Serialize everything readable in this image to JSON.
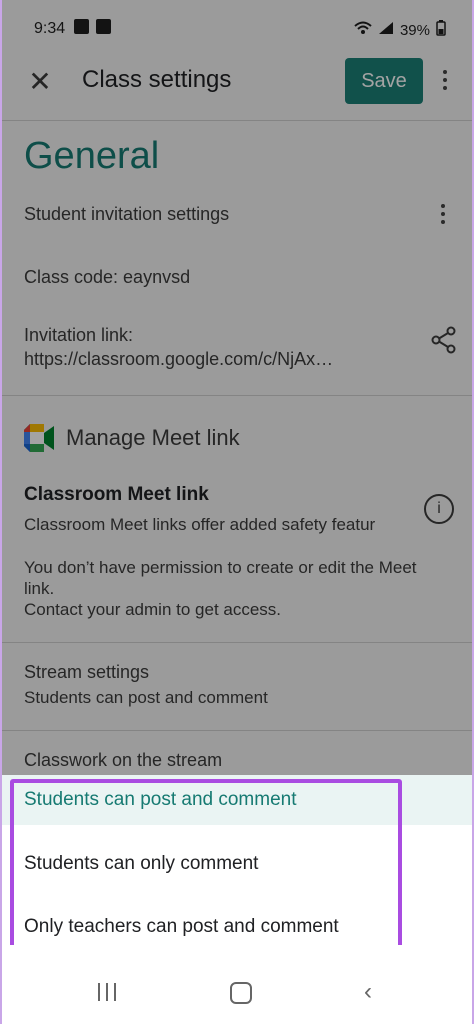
{
  "status_bar": {
    "time": "9:34",
    "battery": "39%"
  },
  "app_bar": {
    "title": "Class settings",
    "save_label": "Save"
  },
  "general": {
    "heading": "General",
    "student_invitation": "Student invitation settings",
    "class_code": "Class code: eaynvsd",
    "invitation_link_label": "Invitation link:",
    "invitation_link_value": "https://classroom.google.com/c/NjAx…"
  },
  "meet": {
    "heading": "Manage Meet link",
    "classroom_meet_title": "Classroom Meet link",
    "classroom_meet_desc": "Classroom Meet links offer added safety featur",
    "permission_line1": "You don’t have permission to create or edit the Meet",
    "permission_line2": "link.",
    "permission_line3": "Contact your admin to get access."
  },
  "stream": {
    "title": "Stream settings",
    "value": "Students can post and comment",
    "classwork": "Classwork on the stream"
  },
  "sheet_options": [
    {
      "label": "Students can post and comment",
      "selected": true
    },
    {
      "label": "Students can only comment",
      "selected": false
    },
    {
      "label": "Only teachers can post and comment",
      "selected": false
    }
  ],
  "colors": {
    "accent": "#167a72",
    "save_bg": "#1b7f76",
    "highlight_border": "#a94ce1"
  },
  "icons": [
    "close-icon",
    "more-vert-icon",
    "share-icon",
    "google-meet-icon",
    "info-icon",
    "recents-icon",
    "home-icon",
    "back-icon"
  ]
}
